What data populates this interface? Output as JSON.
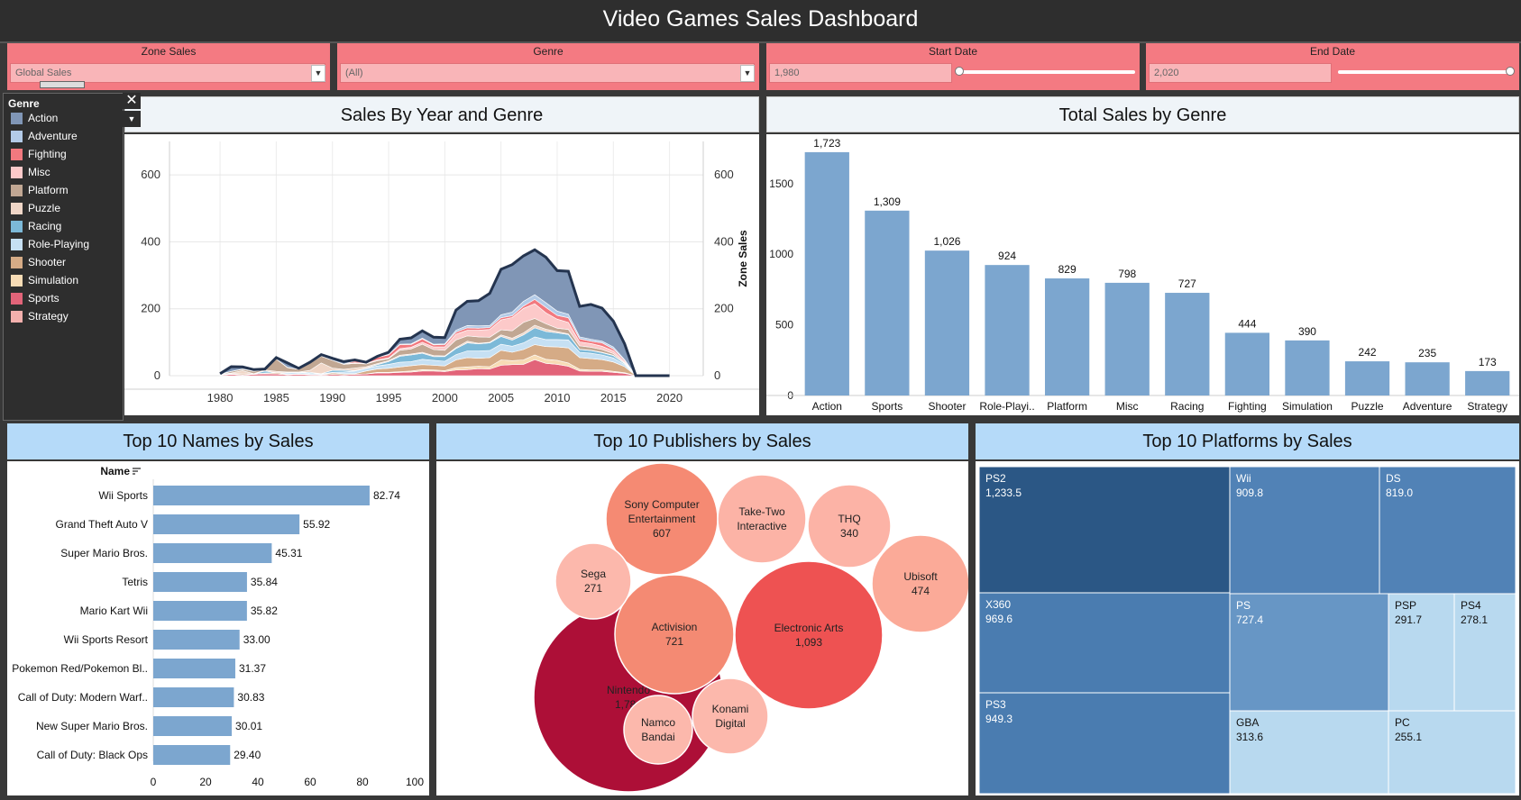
{
  "dashboard": {
    "title": "Video Games Sales Dashboard"
  },
  "filters": {
    "zone": {
      "label": "Zone Sales",
      "value": "Global Sales"
    },
    "genre": {
      "label": "Genre",
      "value": "(All)"
    },
    "start": {
      "label": "Start Date",
      "value": "1,980"
    },
    "end": {
      "label": "End Date",
      "value": "2,020"
    }
  },
  "legend": {
    "title": "Genre",
    "items": [
      {
        "name": "Action",
        "color": "#8096b6"
      },
      {
        "name": "Adventure",
        "color": "#b3cbe8"
      },
      {
        "name": "Fighting",
        "color": "#f2797f"
      },
      {
        "name": "Misc",
        "color": "#fcc9c9"
      },
      {
        "name": "Platform",
        "color": "#c1a793"
      },
      {
        "name": "Puzzle",
        "color": "#f0d6c7"
      },
      {
        "name": "Racing",
        "color": "#7cb9d8"
      },
      {
        "name": "Role-Playing",
        "color": "#c6e0f3"
      },
      {
        "name": "Shooter",
        "color": "#d5ab86"
      },
      {
        "name": "Simulation",
        "color": "#f7dcb5"
      },
      {
        "name": "Sports",
        "color": "#e26479"
      },
      {
        "name": "Strategy",
        "color": "#f4b0ad"
      }
    ]
  },
  "panels": {
    "year_genre": "Sales By Year and Genre",
    "genre_totals": "Total Sales by Genre",
    "names": "Top 10 Names by Sales",
    "publishers": "Top 10 Publishers by Sales",
    "platforms": "Top 10 Platforms by Sales"
  },
  "chart_data": [
    {
      "type": "area",
      "title": "Sales By Year and Genre",
      "ylabel": "Zone Sales",
      "x_ticks": [
        1980,
        1985,
        1990,
        1995,
        2000,
        2005,
        2010,
        2015,
        2020
      ],
      "y_ticks": [
        0,
        200,
        400,
        600
      ],
      "ylim": [
        0,
        700
      ],
      "xlim": [
        1975.5,
        2023
      ],
      "x": [
        1980,
        1981,
        1982,
        1983,
        1984,
        1985,
        1986,
        1987,
        1988,
        1989,
        1990,
        1991,
        1992,
        1993,
        1994,
        1995,
        1996,
        1997,
        1998,
        1999,
        2000,
        2001,
        2002,
        2003,
        2004,
        2005,
        2006,
        2007,
        2008,
        2009,
        2010,
        2011,
        2012,
        2013,
        2014,
        2015,
        2016,
        2017,
        2018,
        2019,
        2020
      ],
      "series": [
        {
          "name": "Sports",
          "values": [
            1,
            4,
            2,
            4,
            6,
            5,
            3,
            4,
            3,
            2,
            4,
            3,
            4,
            5,
            8,
            8,
            10,
            11,
            14,
            14,
            12,
            17,
            18,
            21,
            20,
            31,
            33,
            34,
            48,
            37,
            34,
            28,
            14,
            13,
            13,
            10,
            7,
            0,
            0,
            0,
            0
          ]
        },
        {
          "name": "Simulation",
          "values": [
            0,
            0,
            0,
            0,
            0,
            0,
            0,
            0,
            0,
            0,
            0,
            0,
            0,
            0,
            2,
            2,
            2,
            3,
            4,
            3,
            3,
            7,
            8,
            7,
            7,
            16,
            12,
            13,
            14,
            12,
            12,
            10,
            5,
            4,
            4,
            3,
            2,
            0,
            0,
            0,
            0
          ]
        },
        {
          "name": "Shooter",
          "values": [
            1,
            2,
            3,
            1,
            2,
            4,
            1,
            2,
            1,
            1,
            4,
            3,
            2,
            9,
            10,
            12,
            14,
            16,
            15,
            14,
            14,
            23,
            28,
            24,
            27,
            29,
            25,
            31,
            31,
            38,
            40,
            45,
            35,
            34,
            31,
            28,
            18,
            0,
            0,
            0,
            0
          ]
        },
        {
          "name": "Role-Playing",
          "values": [
            0,
            0,
            0,
            0,
            0,
            0,
            4,
            4,
            3,
            2,
            2,
            5,
            8,
            8,
            9,
            12,
            14,
            12,
            16,
            15,
            14,
            16,
            20,
            22,
            21,
            18,
            18,
            20,
            23,
            21,
            22,
            24,
            16,
            16,
            14,
            12,
            6,
            0,
            0,
            0,
            0
          ]
        },
        {
          "name": "Racing",
          "values": [
            0,
            0,
            0,
            0,
            6,
            0,
            1,
            0,
            3,
            1,
            6,
            5,
            1,
            1,
            4,
            8,
            18,
            20,
            18,
            11,
            14,
            18,
            24,
            21,
            23,
            23,
            18,
            24,
            27,
            24,
            20,
            16,
            8,
            8,
            7,
            7,
            3,
            0,
            0,
            0,
            0
          ]
        },
        {
          "name": "Puzzle",
          "values": [
            1,
            2,
            10,
            1,
            3,
            4,
            2,
            1,
            6,
            32,
            7,
            3,
            8,
            4,
            3,
            3,
            3,
            3,
            3,
            3,
            2,
            3,
            5,
            2,
            2,
            5,
            6,
            6,
            8,
            7,
            4,
            2,
            1,
            1,
            1,
            1,
            0,
            0,
            0,
            0,
            0
          ]
        },
        {
          "name": "Platform",
          "values": [
            0,
            5,
            4,
            7,
            1,
            37,
            13,
            8,
            22,
            20,
            23,
            15,
            14,
            8,
            9,
            6,
            15,
            15,
            24,
            18,
            17,
            23,
            16,
            19,
            15,
            15,
            22,
            31,
            20,
            16,
            10,
            13,
            10,
            9,
            8,
            5,
            2,
            0,
            0,
            0,
            0
          ]
        },
        {
          "name": "Misc",
          "values": [
            1,
            0,
            1,
            2,
            1,
            0,
            0,
            0,
            0,
            1,
            0,
            1,
            2,
            2,
            2,
            2,
            5,
            5,
            6,
            8,
            10,
            17,
            17,
            20,
            23,
            30,
            40,
            42,
            44,
            33,
            27,
            21,
            12,
            11,
            10,
            8,
            3,
            0,
            0,
            0,
            0
          ]
        },
        {
          "name": "Fighting",
          "values": [
            1,
            0,
            0,
            0,
            0,
            0,
            1,
            0,
            0,
            0,
            0,
            0,
            5,
            2,
            8,
            9,
            12,
            8,
            10,
            6,
            7,
            6,
            7,
            6,
            6,
            6,
            5,
            7,
            13,
            16,
            11,
            14,
            9,
            7,
            10,
            6,
            4,
            0,
            0,
            0,
            0
          ]
        },
        {
          "name": "Adventure",
          "values": [
            0,
            0,
            0,
            0,
            0,
            0,
            0,
            0,
            0,
            0,
            0,
            0,
            0,
            0,
            0,
            1,
            1,
            2,
            2,
            2,
            2,
            6,
            7,
            7,
            6,
            9,
            11,
            14,
            14,
            14,
            13,
            11,
            6,
            6,
            5,
            6,
            3,
            0,
            0,
            0,
            0
          ]
        },
        {
          "name": "Action",
          "values": [
            1,
            14,
            6,
            3,
            1,
            4,
            13,
            3,
            2,
            4,
            6,
            7,
            3,
            1,
            3,
            7,
            15,
            18,
            22,
            21,
            19,
            60,
            72,
            75,
            96,
            136,
            142,
            136,
            134,
            136,
            121,
            128,
            91,
            104,
            99,
            77,
            47,
            0,
            0,
            0,
            0
          ]
        },
        {
          "name": "Strategy",
          "values": [
            0,
            0,
            0,
            0,
            0,
            0,
            0,
            0,
            0,
            0,
            0,
            0,
            0,
            0,
            0,
            0,
            0,
            0,
            0,
            0,
            0,
            0,
            0,
            0,
            0,
            0,
            0,
            0,
            0,
            0,
            0,
            0,
            0,
            0,
            0,
            0,
            0,
            0,
            0,
            0,
            0
          ]
        }
      ]
    },
    {
      "type": "bar",
      "title": "Total Sales by Genre",
      "ylabel": "Zone Sales",
      "categories": [
        "Action",
        "Sports",
        "Shooter",
        "Role-Playi..",
        "Platform",
        "Misc",
        "Racing",
        "Fighting",
        "Simulation",
        "Puzzle",
        "Adventure",
        "Strategy"
      ],
      "values": [
        1723,
        1309,
        1026,
        924,
        829,
        798,
        727,
        444,
        390,
        242,
        235,
        173
      ],
      "value_labels": [
        "1,723",
        "1,309",
        "1,026",
        "924",
        "829",
        "798",
        "727",
        "444",
        "390",
        "242",
        "235",
        "173"
      ],
      "y_ticks": [
        0,
        500,
        1000,
        1500
      ],
      "y_tick_labels": [
        "0",
        "500",
        "1000",
        "1500"
      ],
      "ylim": [
        0,
        1850
      ],
      "color": "#7ca6cf"
    },
    {
      "type": "bar",
      "orientation": "horizontal",
      "title": "Top 10 Names by Sales",
      "axis_header": "Name",
      "categories": [
        "Wii Sports",
        "Grand Theft Auto V",
        "Super Mario Bros.",
        "Tetris",
        "Mario Kart Wii",
        "Wii Sports Resort",
        "Pokemon Red/Pokemon Bl..",
        "Call of Duty: Modern Warf..",
        "New Super Mario Bros.",
        "Call of Duty: Black Ops"
      ],
      "values": [
        82.74,
        55.92,
        45.31,
        35.84,
        35.82,
        33.0,
        31.37,
        30.83,
        30.01,
        29.4
      ],
      "value_labels": [
        "82.74",
        "55.92",
        "45.31",
        "35.84",
        "35.82",
        "33.00",
        "31.37",
        "30.83",
        "30.01",
        "29.40"
      ],
      "x_ticks": [
        0,
        20,
        40,
        60,
        80,
        100
      ],
      "xlim": [
        0,
        100
      ],
      "color": "#7ca6cf"
    },
    {
      "type": "bubble",
      "title": "Top 10 Publishers by Sales",
      "items": [
        {
          "name": "Nintendo",
          "value": 1784,
          "label": "1,784"
        },
        {
          "name": "Electronic Arts",
          "value": 1093,
          "label": "1,093"
        },
        {
          "name": "Activision",
          "value": 721,
          "label": "721"
        },
        {
          "name": "Sony Computer Entertainment",
          "value": 607,
          "label": "607"
        },
        {
          "name": "Ubisoft",
          "value": 474,
          "label": "474"
        },
        {
          "name": "Take-Two Interactive",
          "value": 0,
          "label": ""
        },
        {
          "name": "THQ",
          "value": 340,
          "label": "340"
        },
        {
          "name": "Konami Digital",
          "value": 0,
          "label": ""
        },
        {
          "name": "Sega",
          "value": 271,
          "label": "271"
        },
        {
          "name": "Namco Bandai",
          "value": 0,
          "label": ""
        }
      ]
    },
    {
      "type": "treemap",
      "title": "Top 10 Platforms by Sales",
      "items": [
        {
          "name": "PS2",
          "value": 1233.5,
          "label": "1,233.5"
        },
        {
          "name": "X360",
          "value": 969.6,
          "label": "969.6"
        },
        {
          "name": "PS3",
          "value": 949.3,
          "label": "949.3"
        },
        {
          "name": "Wii",
          "value": 909.8,
          "label": "909.8"
        },
        {
          "name": "DS",
          "value": 819.0,
          "label": "819.0"
        },
        {
          "name": "PS",
          "value": 727.4,
          "label": "727.4"
        },
        {
          "name": "GBA",
          "value": 313.6,
          "label": "313.6"
        },
        {
          "name": "PSP",
          "value": 291.7,
          "label": "291.7"
        },
        {
          "name": "PS4",
          "value": 278.1,
          "label": "278.1"
        },
        {
          "name": "PC",
          "value": 255.1,
          "label": "255.1"
        }
      ]
    }
  ]
}
